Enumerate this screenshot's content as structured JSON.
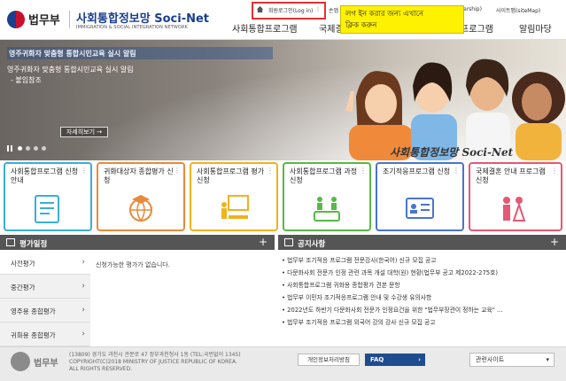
{
  "header": {
    "ministry": "법무부",
    "site_title": "사회통합정보망 Soci-Net",
    "site_subtitle": "IMMIGRATION & SOCIAL INTEGRATION NETWORK",
    "util": {
      "login": "회원로그인(Log in)",
      "sep": "|",
      "partial": "손앱",
      "partner": "ership)",
      "sitemap": "사이트맵(siteMap)"
    },
    "nav": [
      "사회통합프로그램",
      "국제결",
      "프로그램",
      "알림마당"
    ]
  },
  "tooltip": {
    "line1": "লগ ইন করার জন্য এখানে",
    "line2": "ক্লিক করুন"
  },
  "banner": {
    "headline": "영주귀화자 맞춤형 통합시민교육 실시 알림",
    "body_line1": "영주귀화자 맞춤형 통합시민교육 실시 알림",
    "body_line2": "- 붙임참조",
    "more_label": "자세히보기 →",
    "brand_script": "사회통합정보망  Soci-Net"
  },
  "cards": [
    {
      "title": "사회통합프로그램 신청안내",
      "color": "#3aaed8"
    },
    {
      "title": "귀화대상자 종합평가 신청",
      "color": "#e88a3a"
    },
    {
      "title": "사회통합프로그램 평가신청",
      "color": "#f0b21d"
    },
    {
      "title": "사회통합프로그램 과정신청",
      "color": "#58b848"
    },
    {
      "title": "조기적응프로그램 신청",
      "color": "#4b74c8"
    },
    {
      "title": "국제결혼 안내 프로그램 신청",
      "color": "#e55873"
    }
  ],
  "card_more": "⋮",
  "schedule": {
    "title": "평가일정",
    "plus": "+",
    "tabs": [
      "사전평가",
      "중간평가",
      "영주용 종합평가",
      "귀화용 종합평가"
    ],
    "arrow": "›",
    "empty_text": "신청가능한 평가가 없습니다."
  },
  "notices": {
    "title": "공지사항",
    "plus": "+",
    "items": [
      "법무부 조기적응 프로그램 전문강사(한국어) 신규 모집 공고",
      "다문화사회 전문가 인정 관련 과목 개설 대학(원) 현황(법무부 공고 제2022-275호)",
      "사회통합프로그램 귀화용 종합평가 견본 문항",
      "법무부 이민자 조기적응프로그램 안내 및 수강생 유의사항",
      "2022년도 하반기 다문화사회 전문가 인정요건을 위한 \"법무부장관이 정하는 교육\" ...",
      "법무부 조기적응 프로그램 외국어 강의 강사 신규 모집 공고"
    ]
  },
  "footer": {
    "brand": "법무부",
    "address_line1": "(13809) 경기도 과천시 관문로 47 정부과천청사 1동 (TEL:국번없이 1345)",
    "address_line2": "COPYRIGHT(C)2018 MINISTRY OF JUSTICE REPUBLIC OF KOREA.",
    "address_line3": "ALL RIGHTS RESERVED.",
    "privacy": "개인정보처리방침",
    "faq": "FAQ",
    "faq_arrow": "›",
    "related_sites": "관련사이트",
    "related_arrow": "▾"
  }
}
